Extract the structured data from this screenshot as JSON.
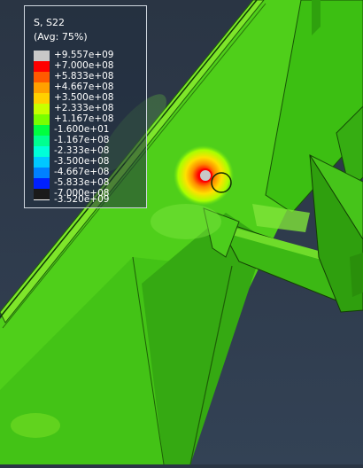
{
  "legend": {
    "title": "S, S22",
    "subtitle": "(Avg: 75%)",
    "entries": [
      {
        "label": "+9.557e+09",
        "color": "#c8c8c8"
      },
      {
        "label": "+7.000e+08",
        "color": "#ff0000"
      },
      {
        "label": "+5.833e+08",
        "color": "#ff5a00"
      },
      {
        "label": "+4.667e+08",
        "color": "#ffa000"
      },
      {
        "label": "+3.500e+08",
        "color": "#ffd000"
      },
      {
        "label": "+2.333e+08",
        "color": "#c8ff00"
      },
      {
        "label": "+1.167e+08",
        "color": "#78ff00"
      },
      {
        "label": "-1.600e+01",
        "color": "#00ff40"
      },
      {
        "label": "-1.167e+08",
        "color": "#00ff90"
      },
      {
        "label": "-2.333e+08",
        "color": "#00ffd8"
      },
      {
        "label": "-3.500e+08",
        "color": "#00c8ff"
      },
      {
        "label": "-4.667e+08",
        "color": "#0080ff"
      },
      {
        "label": "-5.833e+08",
        "color": "#0020ff"
      },
      {
        "label": "-7.000e+08",
        "color": "#1a1a1a"
      }
    ],
    "min_label": "-3.520e+09"
  },
  "colors": {
    "background": "#2e3a4b",
    "beam_main": "#44c414",
    "beam_edge": "#1f6a06",
    "hotspot": "#ff0000"
  }
}
